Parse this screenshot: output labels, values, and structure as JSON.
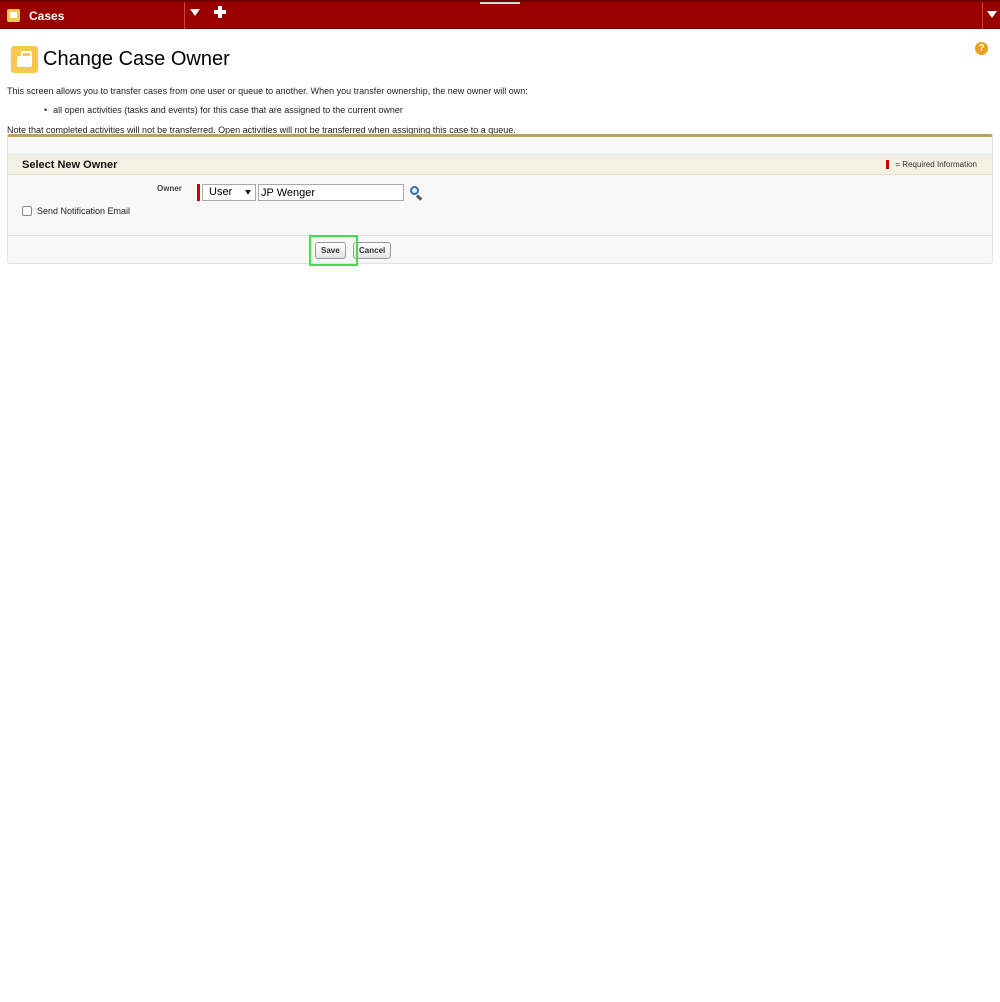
{
  "tabbar": {
    "current_tab": "Cases",
    "dropdown_icon": "caret-down-icon",
    "add_icon": "plus-icon"
  },
  "header": {
    "title": "Change Case Owner",
    "help_glyph": "?"
  },
  "description": {
    "intro": "This screen allows you to transfer cases from one user or queue to another. When you transfer ownership, the new owner will own:",
    "bullets": [
      "all open activities (tasks and events) for this case that are assigned to the current owner"
    ],
    "note": "Note that completed activities will not be transferred. Open activities will not be transferred when assigning this case to a queue."
  },
  "section": {
    "title": "Select New Owner",
    "required_legend": "= Required Information"
  },
  "owner": {
    "label": "Owner",
    "type_value": "User",
    "name_value": "JP Wenger"
  },
  "notification": {
    "label": "Send Notification Email",
    "checked": false
  },
  "buttons": {
    "save_label": "Save",
    "cancel_label": "Cancel"
  },
  "colors": {
    "tabbar": "#9a0000",
    "accent": "#b9a55a",
    "case_icon": "#f6c94a",
    "required": "#cc0000",
    "highlight": "#3fe14a"
  }
}
